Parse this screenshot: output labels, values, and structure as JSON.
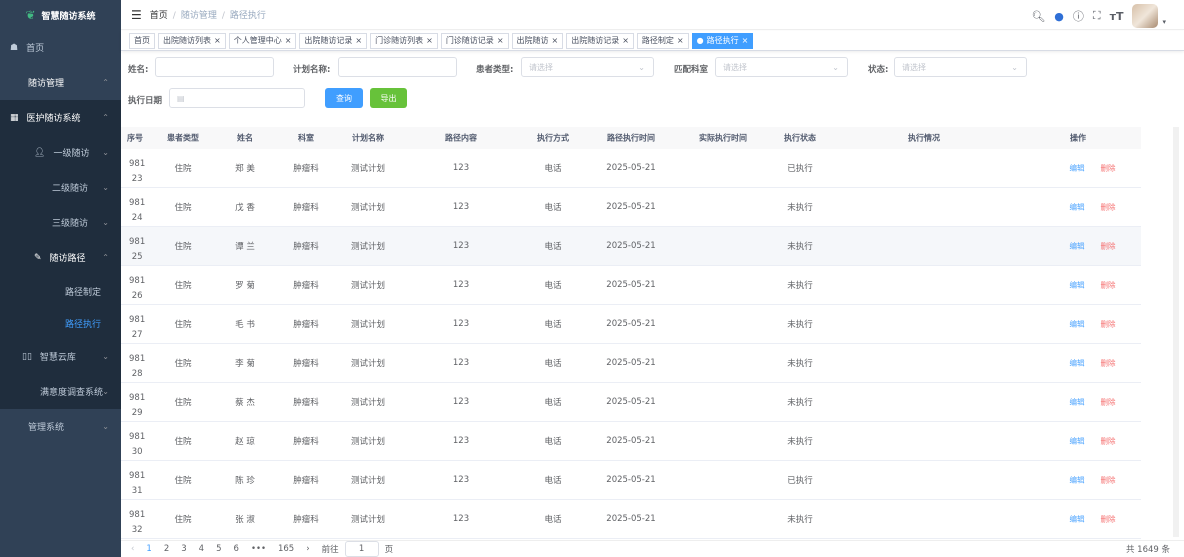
{
  "app": {
    "title": "智慧随访系统"
  },
  "sidebar": {
    "items": [
      {
        "label": "首页",
        "icon": "dashboard-icon"
      },
      {
        "label": "随访管理",
        "icon": "",
        "expanded": true
      },
      {
        "label": "医护随访系统",
        "icon": "table-icon"
      },
      {
        "label": "一级随访",
        "icon": "user-icon"
      },
      {
        "label": "二级随访"
      },
      {
        "label": "三级随访"
      },
      {
        "label": "随访路径",
        "icon": "edit-icon",
        "expanded": true
      },
      {
        "label": "路径制定"
      },
      {
        "label": "路径执行",
        "active": true
      },
      {
        "label": "智慧云库",
        "icon": "book-icon"
      },
      {
        "label": "满意度调查系统"
      },
      {
        "label": "管理系统"
      }
    ]
  },
  "breadcrumb": [
    "首页",
    "随访管理",
    "路径执行"
  ],
  "tags": [
    "首页",
    "出院随访列表",
    "个人管理中心",
    "出院随访记录",
    "门诊随访列表",
    "门诊随访记录",
    "出院随访",
    "出院随访记录",
    "路径制定",
    "路径执行"
  ],
  "filters": {
    "name_label": "姓名:",
    "plan_label": "计划名称:",
    "patient_type_label": "患者类型:",
    "dept_label": "匹配科室",
    "status_label": "状态:",
    "date_label": "执行日期",
    "select_placeholder": "请选择",
    "query_label": "查询",
    "export_label": "导出"
  },
  "table": {
    "headers": [
      "序号",
      "患者类型",
      "姓名",
      "科室",
      "计划名称",
      "路径内容",
      "执行方式",
      "路径执行时间",
      "实际执行时间",
      "执行状态",
      "执行情况",
      "操作"
    ],
    "edit_label": "编辑",
    "delete_label": "删除",
    "rows": [
      {
        "id": "98123",
        "type": "住院",
        "name": "郑  美",
        "dept": "肿瘤科",
        "plan": "测试计划",
        "content": "123",
        "method": "电话",
        "time": "2025-05-21",
        "actual": "",
        "status": "已执行",
        "situation": ""
      },
      {
        "id": "98124",
        "type": "住院",
        "name": "戊  香",
        "dept": "肿瘤科",
        "plan": "测试计划",
        "content": "123",
        "method": "电话",
        "time": "2025-05-21",
        "actual": "",
        "status": "未执行",
        "situation": ""
      },
      {
        "id": "98125",
        "type": "住院",
        "name": "谭  兰",
        "dept": "肿瘤科",
        "plan": "测试计划",
        "content": "123",
        "method": "电话",
        "time": "2025-05-21",
        "actual": "",
        "status": "未执行",
        "situation": ""
      },
      {
        "id": "98126",
        "type": "住院",
        "name": "罗  菊",
        "dept": "肿瘤科",
        "plan": "测试计划",
        "content": "123",
        "method": "电话",
        "time": "2025-05-21",
        "actual": "",
        "status": "未执行",
        "situation": ""
      },
      {
        "id": "98127",
        "type": "住院",
        "name": "毛  书",
        "dept": "肿瘤科",
        "plan": "测试计划",
        "content": "123",
        "method": "电话",
        "time": "2025-05-21",
        "actual": "",
        "status": "未执行",
        "situation": ""
      },
      {
        "id": "98128",
        "type": "住院",
        "name": "李  菊",
        "dept": "肿瘤科",
        "plan": "测试计划",
        "content": "123",
        "method": "电话",
        "time": "2025-05-21",
        "actual": "",
        "status": "未执行",
        "situation": ""
      },
      {
        "id": "98129",
        "type": "住院",
        "name": "蔡  杰",
        "dept": "肿瘤科",
        "plan": "测试计划",
        "content": "123",
        "method": "电话",
        "time": "2025-05-21",
        "actual": "",
        "status": "未执行",
        "situation": ""
      },
      {
        "id": "98130",
        "type": "住院",
        "name": "赵  琼",
        "dept": "肿瘤科",
        "plan": "测试计划",
        "content": "123",
        "method": "电话",
        "time": "2025-05-21",
        "actual": "",
        "status": "未执行",
        "situation": ""
      },
      {
        "id": "98131",
        "type": "住院",
        "name": "陈  珍",
        "dept": "肿瘤科",
        "plan": "测试计划",
        "content": "123",
        "method": "电话",
        "time": "2025-05-21",
        "actual": "",
        "status": "已执行",
        "situation": ""
      },
      {
        "id": "98132",
        "type": "住院",
        "name": "张  淑",
        "dept": "肿瘤科",
        "plan": "测试计划",
        "content": "123",
        "method": "电话",
        "time": "2025-05-21",
        "actual": "",
        "status": "未执行",
        "situation": ""
      }
    ]
  },
  "pagination": {
    "pages": [
      "1",
      "2",
      "3",
      "4",
      "5",
      "6",
      "•••",
      "165"
    ],
    "current": "1",
    "goto_prefix": "前往",
    "goto_value": "1",
    "goto_suffix": "页",
    "total": "共 1649 条"
  },
  "colors": {
    "sidebar": "#304156",
    "accent": "#409eff",
    "success": "#67c23a",
    "danger": "#f56c6c"
  }
}
